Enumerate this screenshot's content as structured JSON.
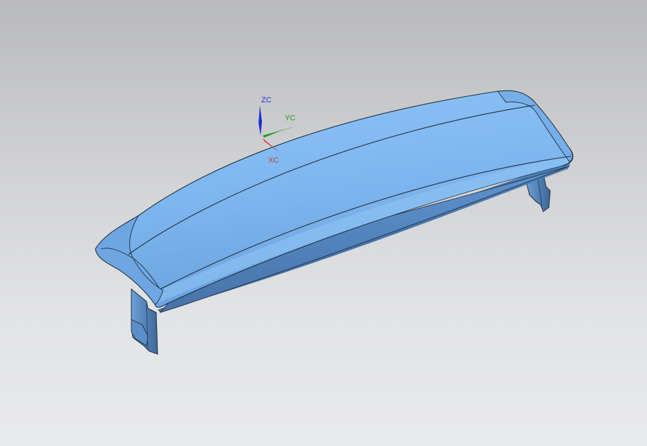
{
  "viewport": {
    "background_top": "#b9babc",
    "background_bottom": "#e9eaec"
  },
  "model": {
    "body_color": "#7fb6f0",
    "shadow_color": "#4f7fb8",
    "edge_color": "#1f2c3a"
  },
  "triad": {
    "z_label": "ZC",
    "y_label": "YC",
    "x_label": "XC",
    "z_color": "#1b2fd6",
    "y_color": "#1e9a1e",
    "x_color": "#cf3a3a"
  }
}
